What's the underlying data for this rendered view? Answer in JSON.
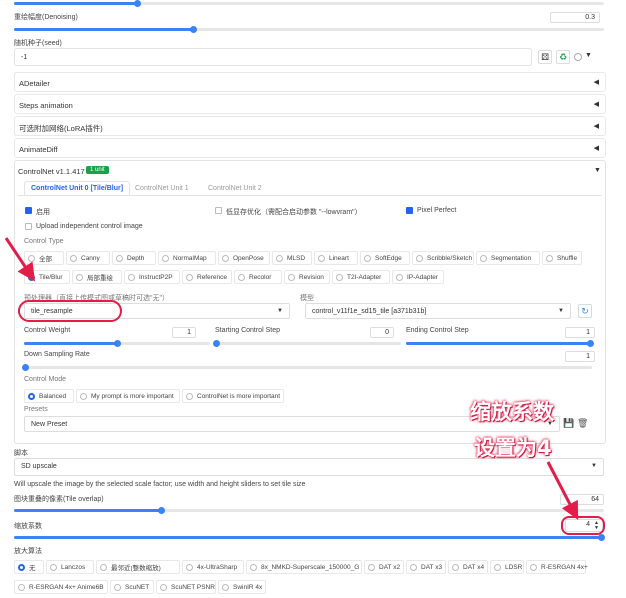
{
  "top": {
    "denoise_label": "重绘幅度(Denoising)",
    "denoise_value": "0.3",
    "seed_label": "随机种子(seed)",
    "seed_value": "-1"
  },
  "accordions": [
    {
      "title": "ADetailer",
      "arrow": "◀"
    },
    {
      "title": "Steps animation",
      "arrow": "◀"
    },
    {
      "title": "可选附加网络(LoRA插件)",
      "arrow": "◀"
    },
    {
      "title": "AnimateDiff",
      "arrow": "◀"
    }
  ],
  "controlnet": {
    "title": "ControlNet v1.1.417",
    "badge": "1 unit",
    "arrow": "▼",
    "tabs": [
      "ControlNet Unit 0 [Tile/Blur]",
      "ControlNet Unit 1",
      "ControlNet Unit 2"
    ],
    "enable_label": "启用",
    "lowvram_label": "低显存优化（需配合启动参数 \"--lowvram\"）",
    "pixel_perfect_label": "Pixel Perfect",
    "upload_label": "Upload independent control image",
    "control_type_label": "Control Type",
    "types_row1": [
      "全部",
      "Canny",
      "Depth",
      "NormalMap",
      "OpenPose",
      "MLSD",
      "Lineart",
      "SoftEdge",
      "Scribble/Sketch",
      "Segmentation",
      "Shuffle"
    ],
    "types_row2": [
      "Tile/Blur",
      "局部重绘",
      "InstructP2P",
      "Reference",
      "Recolor",
      "Revision",
      "T2I-Adapter",
      "IP-Adapter"
    ],
    "selected_type": "Tile/Blur",
    "preprocessor_label": "预处理器（直接上传模式图或草稿时可选\"无\"）",
    "preprocessor_value": "tile_resample",
    "model_label": "模型",
    "model_value": "control_v11f1e_sd15_tile [a371b31b]",
    "weight_label": "Control Weight",
    "weight_value": "1",
    "start_label": "Starting Control Step",
    "start_value": "0",
    "end_label": "Ending Control Step",
    "end_value": "1",
    "downsample_label": "Down Sampling Rate",
    "downsample_value": "1",
    "mode_label": "Control Mode",
    "modes": [
      "Balanced",
      "My prompt is more important",
      "ControlNet is more important"
    ],
    "presets_label": "Presets",
    "presets_value": "New Preset"
  },
  "script": {
    "label": "脚本",
    "value": "SD upscale",
    "desc": "Will upscale the image by the selected scale factor; use width and height sliders to set tile size",
    "overlap_label": "图块重叠的像素(Tile overlap)",
    "overlap_value": "64",
    "scale_label": "缩放系数",
    "scale_value": "4",
    "upscaler_label": "放大算法",
    "upscalers_row1": [
      "无",
      "Lanczos",
      "最邻近(整数缩放)",
      "4x-UltraSharp",
      "8x_NMKD-Superscale_150000_G",
      "DAT x2",
      "DAT x3",
      "DAT x4",
      "LDSR",
      "R-ESRGAN 4x+"
    ],
    "upscalers_row2": [
      "R-ESRGAN 4x+ Anime6B",
      "ScuNET",
      "ScuNET PSNR",
      "SwinIR 4x"
    ],
    "selected_upscaler": "无"
  },
  "annotation": {
    "line1": "缩放系数",
    "line2": "设置为4"
  },
  "colors": {
    "accent": "#3b82f6",
    "highlight": "#e11d48",
    "badge": "#16a34a"
  },
  "icons": [
    "dice-icon",
    "recycle-icon",
    "refresh-icon",
    "save-icon",
    "delete-icon"
  ]
}
